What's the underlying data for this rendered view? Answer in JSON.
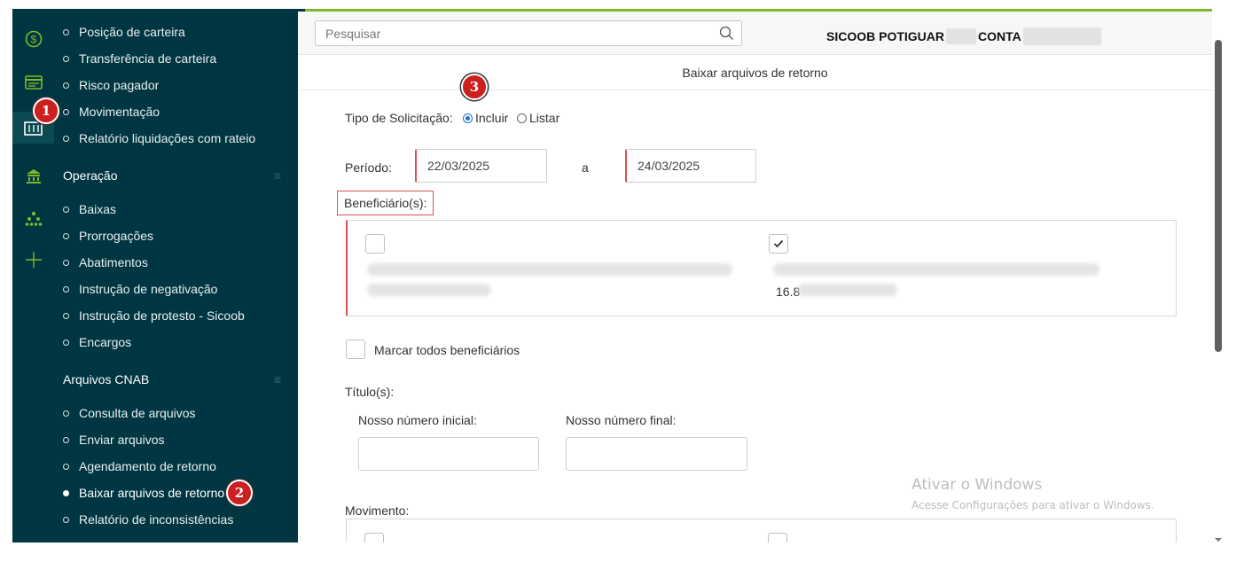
{
  "search": {
    "placeholder": "Pesquisar"
  },
  "account": {
    "cooperative": "SICOOB POTIGUAR",
    "conta_label": "CONTA"
  },
  "page": {
    "subtitle": "Baixar arquivos de retorno"
  },
  "menu": {
    "group1": [
      "Posição de carteira",
      "Transferência de carteira",
      "Risco pagador",
      "Movimentação",
      "Relatório liquidações com rateio"
    ],
    "section_operacao": "Operação",
    "group2": [
      "Baixas",
      "Prorrogações",
      "Abatimentos",
      "Instrução de negativação",
      "Instrução de protesto - Sicoob",
      "Encargos"
    ],
    "section_arquivos": "Arquivos CNAB",
    "group3": [
      "Consulta de arquivos",
      "Enviar arquivos",
      "Agendamento de retorno",
      "Baixar arquivos de retorno",
      "Relatório de inconsistências"
    ]
  },
  "form": {
    "tipo_label": "Tipo de Solicitação:",
    "opt_incluir": "Incluir",
    "opt_listar": "Listar",
    "periodo_label": "Período:",
    "date_from": "22/03/2025",
    "date_sep": "a",
    "date_to": "24/03/2025",
    "beneficiarios_label": "Beneficiário(s):",
    "beneficiary_partial": "16.8",
    "marcar_todos": "Marcar todos beneficiários",
    "titulos_label": "Título(s):",
    "nosso_inicial": "Nosso número inicial:",
    "nosso_final": "Nosso número final:",
    "movimento_label": "Movimento:"
  },
  "watermark": {
    "title": "Ativar o Windows",
    "subtitle": "Acesse Configurações para ativar o Windows."
  },
  "badges": [
    "1",
    "2",
    "3"
  ],
  "colors": {
    "sidebar": "#003641",
    "accent_green": "#7db928",
    "teal": "#00ae9d",
    "error_red": "#d9534f",
    "badge_red": "#cc1f1f",
    "radio_blue": "#1a6fd1"
  }
}
